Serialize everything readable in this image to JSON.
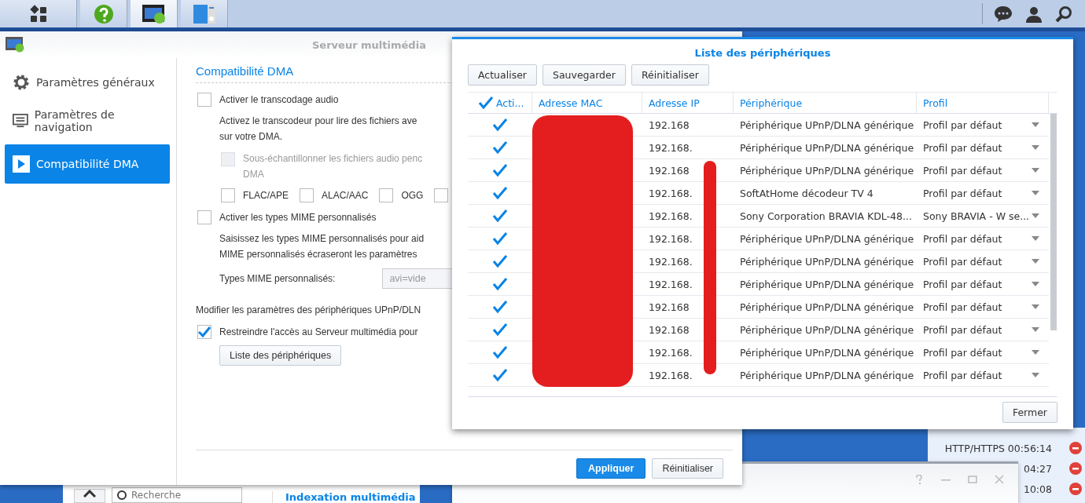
{
  "taskbar": {
    "apps": [
      {
        "kind": "grid",
        "selected": false
      },
      {
        "kind": "help",
        "selected": false
      },
      {
        "kind": "media",
        "selected": true
      },
      {
        "kind": "panel",
        "selected": false
      }
    ]
  },
  "main_window": {
    "title": "Serveur multimédia",
    "sidebar": [
      {
        "kind": "gear",
        "label": "Paramètres généraux",
        "selected": false
      },
      {
        "kind": "list",
        "label": "Paramètres de navigation",
        "selected": false
      },
      {
        "kind": "play",
        "label": "Compatibilité DMA",
        "selected": true
      }
    ],
    "section_title": "Compatibilité DMA",
    "transcode": {
      "label": "Activer le transcodage audio",
      "checked": false,
      "hint": [
        "Activez le transcodeur pour lire des fichiers ave",
        "sur votre DMA."
      ]
    },
    "downsample": {
      "label": [
        "Sous-échantillonner les fichiers audio penc",
        "DMA"
      ],
      "checked": false,
      "disabled": true
    },
    "codecs": [
      {
        "label": "FLAC/APE",
        "checked": false
      },
      {
        "label": "ALAC/AAC",
        "checked": false
      },
      {
        "label": "OGG",
        "checked": false
      },
      {
        "checked": false
      }
    ],
    "mime": {
      "label": "Activer les types MIME personnalisés",
      "checked": false,
      "hint": [
        "Saisissez les types MIME personnalisés pour aid",
        "MIME personnalisés écraseront les paramètres"
      ],
      "field_label": "Types MIME personnalisés:",
      "value": "avi=vide"
    },
    "upnp_note": "Modifier les paramètres des périphériques UPnP/DLN",
    "restrict": {
      "label": "Restreindre l'accès au Serveur multimédia pour",
      "checked": true
    },
    "device_list_button": "Liste des périphériques",
    "buttons": [
      {
        "label": "Appliquer",
        "kind": "primary"
      },
      {
        "label": "Réinitialiser",
        "kind": "plain"
      }
    ]
  },
  "device_dialog": {
    "title": "Liste des périphériques",
    "toolbar": [
      "Actualiser",
      "Sauvegarder",
      "Réinitialiser"
    ],
    "header_checked": true,
    "columns": [
      "Acti...",
      "Adresse MAC",
      "Adresse IP",
      "Périphérique",
      "Profil"
    ],
    "rows": [
      {
        "enabled": true,
        "ip": "192.168",
        "device": "Périphérique UPnP/DLNA générique",
        "profile": "Profil par défaut"
      },
      {
        "enabled": true,
        "ip": "192.168.",
        "device": "Périphérique UPnP/DLNA générique",
        "profile": "Profil par défaut"
      },
      {
        "enabled": true,
        "ip": "192.168",
        "device": "Périphérique UPnP/DLNA générique",
        "profile": "Profil par défaut"
      },
      {
        "enabled": true,
        "ip": "192.168.",
        "device": "SoftAtHome décodeur TV 4",
        "profile": "Profil par défaut"
      },
      {
        "enabled": true,
        "ip": "192.168.",
        "device": "Sony Corporation BRAVIA KDL-48...",
        "profile": "Sony BRAVIA - W se..."
      },
      {
        "enabled": true,
        "ip": "192.168.",
        "device": "Périphérique UPnP/DLNA générique",
        "profile": "Profil par défaut"
      },
      {
        "enabled": true,
        "ip": "192.168.",
        "device": "Périphérique UPnP/DLNA générique",
        "profile": "Profil par défaut"
      },
      {
        "enabled": true,
        "ip": "192.168.",
        "device": "Périphérique UPnP/DLNA générique",
        "profile": "Profil par défaut"
      },
      {
        "enabled": true,
        "ip": "192.168",
        "device": "Périphérique UPnP/DLNA générique",
        "profile": "Profil par défaut"
      },
      {
        "enabled": true,
        "ip": "192.168",
        "device": "Périphérique UPnP/DLNA générique",
        "profile": "Profil par défaut"
      },
      {
        "enabled": true,
        "ip": "192.168.",
        "device": "Périphérique UPnP/DLNA générique",
        "profile": "Profil par défaut"
      },
      {
        "enabled": true,
        "ip": "192.168.",
        "device": "Périphérique UPnP/DLNA générique",
        "profile": "Profil par défaut"
      }
    ],
    "close_button": "Fermer"
  },
  "connections": [
    "HTTP/HTTPS 00:56:14",
    "04:27",
    "10:08"
  ],
  "back_window": {
    "search_placeholder": "Recherche",
    "tab": "Indexation multimédia"
  }
}
